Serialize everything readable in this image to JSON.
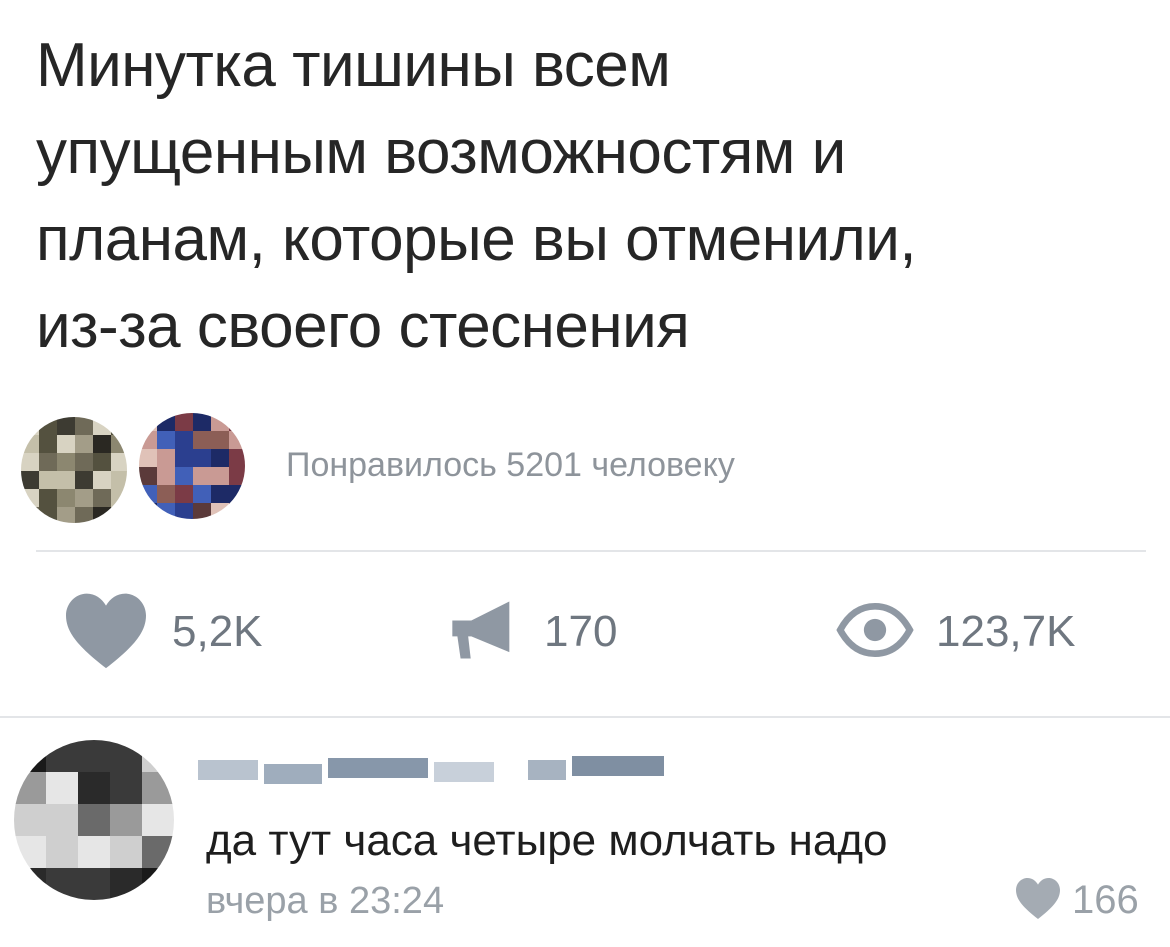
{
  "post": {
    "text_lines": [
      "Минутка тишины всем",
      "упущенным возможностям и",
      "планам, которые вы отменили,",
      "из-за своего стеснения"
    ],
    "likers_text": "Понравилось 5201 человеку"
  },
  "actions": {
    "likes": {
      "icon": "heart-icon",
      "count": "5,2K"
    },
    "reposts": {
      "icon": "megaphone-icon",
      "count": "170"
    },
    "views": {
      "icon": "eye-icon",
      "count": "123,7K"
    }
  },
  "comment": {
    "text": "да тут часа четыре молчать надо",
    "time": "вчера в 23:24",
    "likes": {
      "icon": "heart-icon",
      "count": "166"
    }
  },
  "colors": {
    "text": "#262626",
    "secondary": "#8e949b",
    "icon": "#8f98a3",
    "divider": "#e3e5e8"
  }
}
